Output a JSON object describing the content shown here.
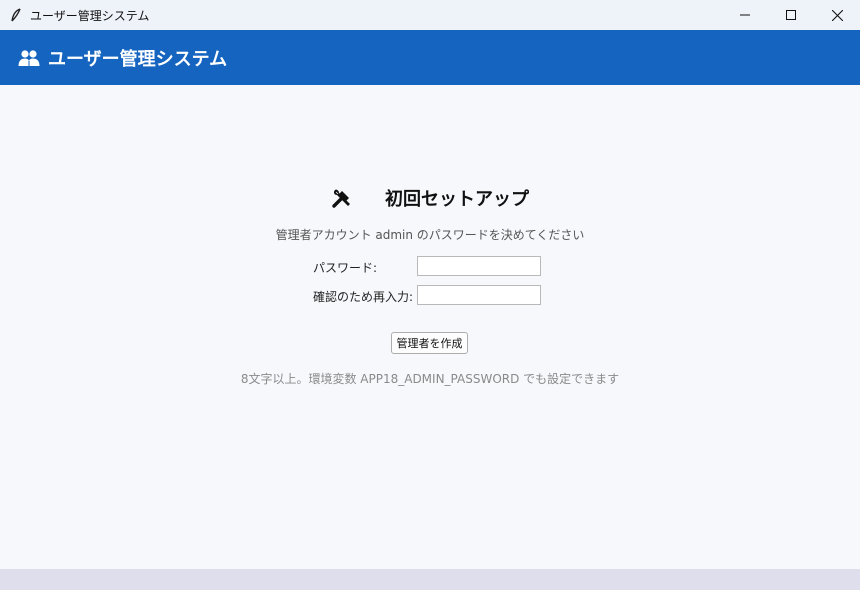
{
  "window": {
    "title": "ユーザー管理システム",
    "icon": "feather-icon",
    "controls": [
      "minimize-icon",
      "maximize-icon",
      "close-icon"
    ]
  },
  "header": {
    "icon": "users-icon",
    "title": "ユーザー管理システム",
    "background": "#1565c0"
  },
  "setup": {
    "icon": "tools-icon",
    "title": "初回セットアップ",
    "subtitle": "管理者アカウント admin のパスワードを決めてください",
    "password_label": "パスワード:",
    "password_value": "",
    "confirm_label": "確認のため再入力:",
    "confirm_value": "",
    "create_button": "管理者を作成",
    "hint": "8文字以上。環境変数 APP18_ADMIN_PASSWORD でも設定できます"
  }
}
